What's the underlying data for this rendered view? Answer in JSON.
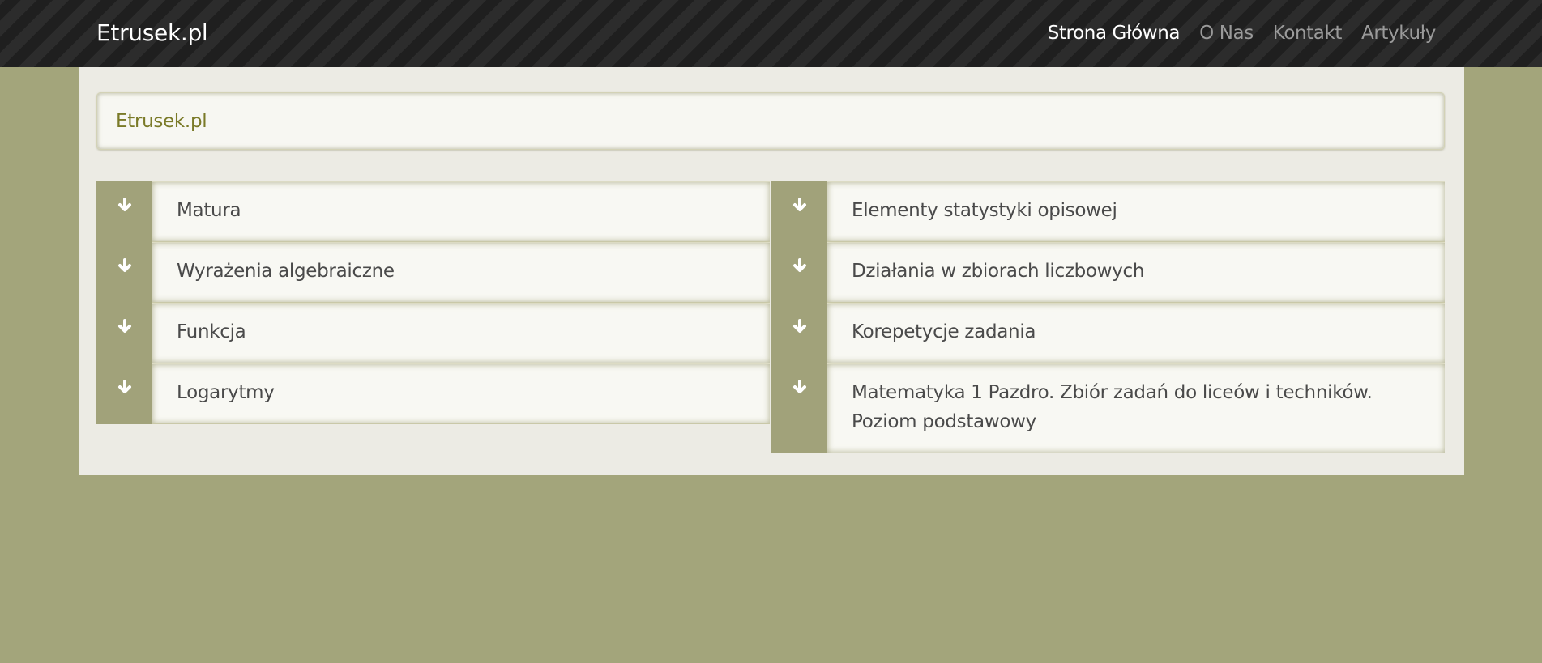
{
  "navbar": {
    "brand": "Etrusek.pl",
    "links": [
      {
        "label": "Strona Główna",
        "active": true
      },
      {
        "label": "O Nas",
        "active": false
      },
      {
        "label": "Kontakt",
        "active": false
      },
      {
        "label": "Artykuły",
        "active": false
      }
    ]
  },
  "breadcrumb": {
    "label": "Etrusek.pl"
  },
  "left_items": [
    {
      "label": "Matura",
      "icon": "arrow-down-icon"
    },
    {
      "label": "Wyrażenia algebraiczne",
      "icon": "arrow-down-icon"
    },
    {
      "label": "Funkcja",
      "icon": "arrow-down-icon"
    },
    {
      "label": "Logarytmy",
      "icon": "arrow-down-icon"
    }
  ],
  "right_items": [
    {
      "label": "Elementy statystyki opisowej",
      "icon": "arrow-down-icon"
    },
    {
      "label": "Działania w zbiorach liczbowych",
      "icon": "arrow-down-icon"
    },
    {
      "label": "Korepetycje zadania",
      "icon": "arrow-down-icon"
    },
    {
      "label": "Matematyka 1 Pazdro. Zbiór zadań do liceów i techników. Poziom podstawowy",
      "icon": "arrow-down-icon"
    }
  ],
  "colors": {
    "page_bg": "#a3a57b",
    "container_bg": "#ecebe4",
    "marker_bg": "#a1a27a",
    "breadcrumb_link": "#7a7a28",
    "nav_active": "#ffffff",
    "nav_inactive": "#9a9a9a"
  }
}
